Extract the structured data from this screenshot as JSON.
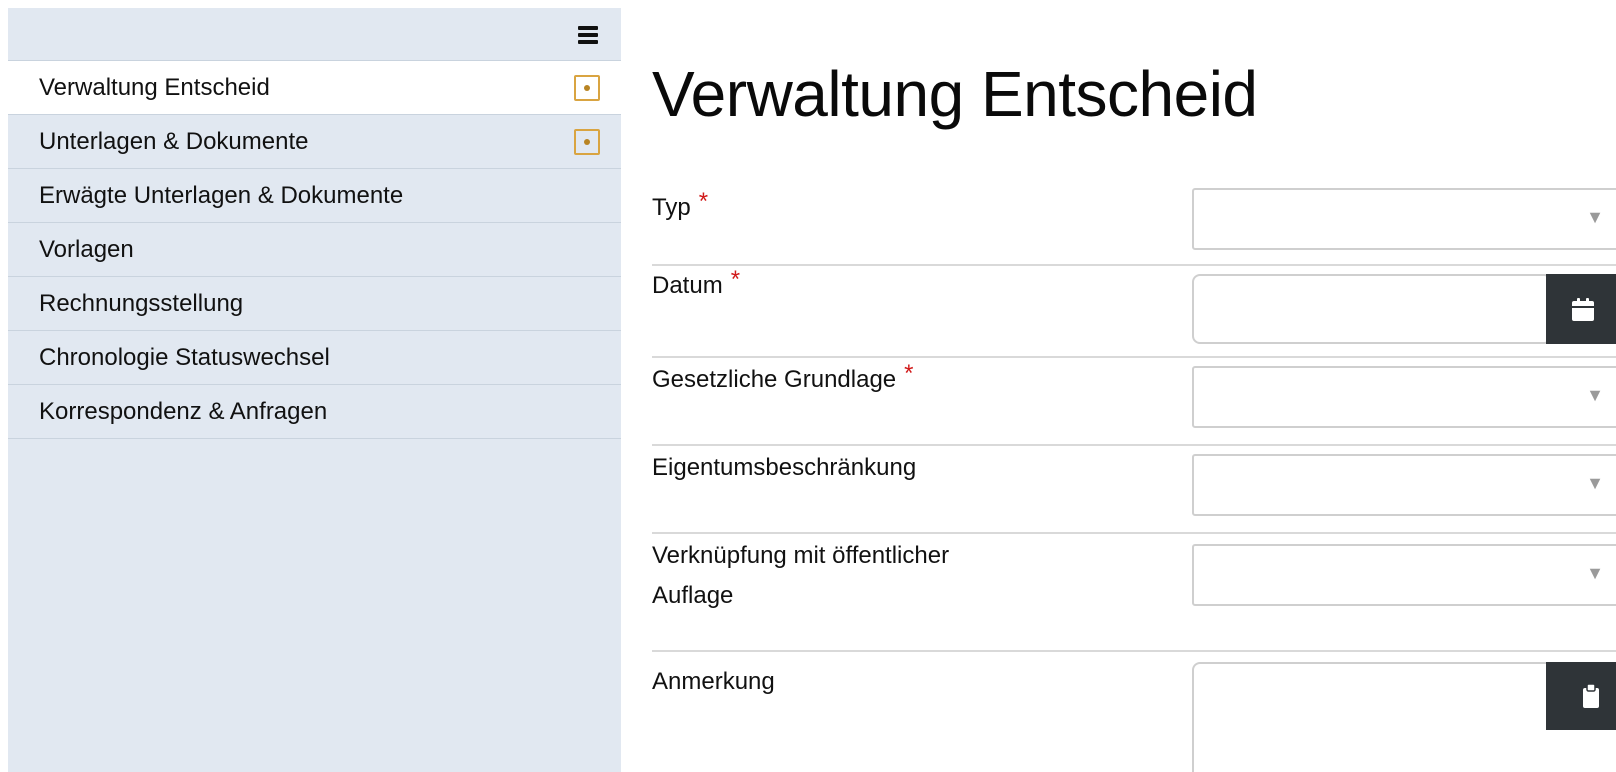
{
  "sidebar": {
    "menu_icon": "hamburger-menu-icon",
    "items": [
      {
        "label": "Verwaltung Entscheid",
        "active": true,
        "status_icon": "status-square-dot-icon"
      },
      {
        "label": "Unterlagen & Dokumente",
        "active": false,
        "status_icon": "status-square-dot-icon"
      },
      {
        "label": "Erwägte Unterlagen & Dokumente",
        "active": false
      },
      {
        "label": "Vorlagen",
        "active": false
      },
      {
        "label": "Rechnungsstellung",
        "active": false
      },
      {
        "label": "Chronologie Statuswechsel",
        "active": false
      },
      {
        "label": "Korrespondenz & Anfragen",
        "active": false
      }
    ]
  },
  "main": {
    "title": "Verwaltung Entscheid",
    "required_marker": "*",
    "fields": {
      "typ": {
        "label": "Typ",
        "required": true,
        "value": ""
      },
      "datum": {
        "label": "Datum",
        "required": true,
        "value": "",
        "button_icon": "calendar-icon"
      },
      "gesetzliche_grundlage": {
        "label": "Gesetzliche Grundlage",
        "required": true,
        "value": ""
      },
      "eigentumsbeschraenkung": {
        "label": "Eigentumsbeschränkung",
        "required": false,
        "value": ""
      },
      "verknuepfung": {
        "label_line1": "Verknüpfung mit öffentlicher",
        "label_line2": "Auflage",
        "required": false,
        "value": ""
      },
      "anmerkung": {
        "label": "Anmerkung",
        "required": false,
        "value": "",
        "button_icon": "clipboard-icon"
      }
    },
    "select_caret": "▼"
  },
  "colors": {
    "sidebar_bg": "#e1e8f1",
    "active_item_bg": "#ffffff",
    "status_icon": "#d9a441",
    "required": "#d11a1a",
    "dark_button": "#2f3438"
  }
}
